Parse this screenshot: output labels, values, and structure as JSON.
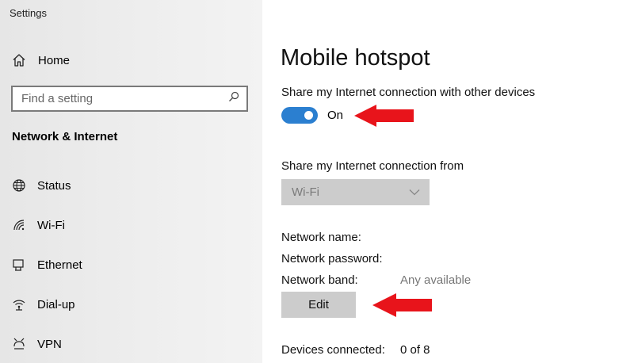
{
  "window": {
    "title": "Settings"
  },
  "sidebar": {
    "home_label": "Home",
    "search_placeholder": "Find a setting",
    "section_title": "Network & Internet",
    "items": [
      {
        "label": "Status",
        "icon": "globe-icon"
      },
      {
        "label": "Wi-Fi",
        "icon": "wifi-icon"
      },
      {
        "label": "Ethernet",
        "icon": "ethernet-icon"
      },
      {
        "label": "Dial-up",
        "icon": "dialup-icon"
      },
      {
        "label": "VPN",
        "icon": "vpn-icon"
      }
    ]
  },
  "main": {
    "title": "Mobile hotspot",
    "share_label": "Share my Internet connection with other devices",
    "toggle_state": "On",
    "share_from_label": "Share my Internet connection from",
    "share_from_value": "Wi-Fi",
    "network_name_label": "Network name:",
    "network_password_label": "Network password:",
    "network_band_label": "Network band:",
    "network_band_value": "Any available",
    "edit_label": "Edit",
    "devices_label": "Devices connected:",
    "devices_value": "0 of 8"
  },
  "colors": {
    "toggle_on": "#2b7fd0",
    "annotation_arrow": "#e8141b",
    "button_bg": "#cccccc"
  }
}
